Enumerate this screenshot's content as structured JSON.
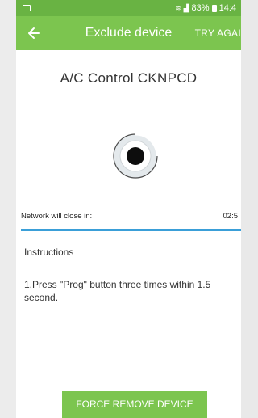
{
  "status_bar": {
    "battery_percent": "83%",
    "time": "14:4"
  },
  "app_bar": {
    "title": "Exclude device",
    "action_label": "TRY AGAI"
  },
  "device": {
    "name": "A/C Control CKNPCD"
  },
  "network": {
    "label": "Network will close in:",
    "time_remaining": "02:5",
    "progress": 1.0
  },
  "instructions": {
    "title": "Instructions",
    "text": "1.Press \"Prog\" button three times within 1.5 second."
  },
  "buttons": {
    "force_remove": "FORCE REMOVE DEVICE"
  },
  "colors": {
    "status_bar": "#69b343",
    "app_bar": "#7cc54f",
    "button": "#7cc54f",
    "progress": "#3a9fd8"
  }
}
